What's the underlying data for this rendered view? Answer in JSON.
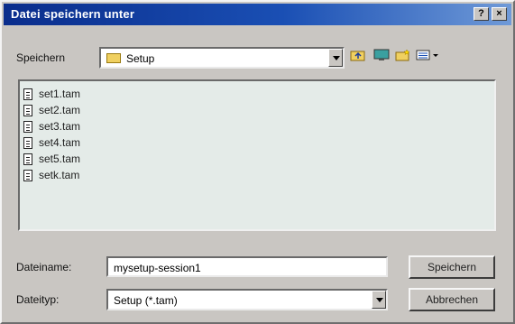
{
  "window": {
    "title": "Datei speichern unter",
    "help_glyph": "?",
    "close_glyph": "×"
  },
  "location": {
    "label": "Speichern",
    "current_folder": "Setup",
    "toolbar_icons": [
      "up-folder-icon",
      "desktop-icon",
      "new-folder-icon",
      "view-menu-icon"
    ]
  },
  "files": [
    {
      "name": "set1.tam"
    },
    {
      "name": "set2.tam"
    },
    {
      "name": "set3.tam"
    },
    {
      "name": "set4.tam"
    },
    {
      "name": "set5.tam"
    },
    {
      "name": "setk.tam"
    }
  ],
  "filename": {
    "label": "Dateiname:",
    "value": "mysetup-session1"
  },
  "filetype": {
    "label": "Dateityp:",
    "selected": "Setup (*.tam)"
  },
  "buttons": {
    "save": "Speichern",
    "cancel": "Abbrechen"
  },
  "colors": {
    "titlebar_start": "#0a2d8c",
    "titlebar_end": "#6f9ad8",
    "dialog_face": "#c9c6c2",
    "list_background": "#e4ebe8"
  }
}
